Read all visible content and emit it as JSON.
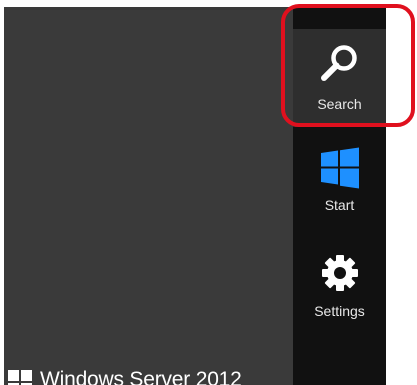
{
  "desktop": {
    "brand_text": "Windows Server 2012"
  },
  "charms": [
    {
      "id": "search",
      "label": "Search",
      "icon": "search-icon"
    },
    {
      "id": "start",
      "label": "Start",
      "icon": "windows-logo-icon"
    },
    {
      "id": "settings",
      "label": "Settings",
      "icon": "gear-icon"
    }
  ],
  "colors": {
    "charms_bar": "#111111",
    "selected_charm": "#2e2e2e",
    "desktop": "#3a3a3a",
    "start_logo": "#1e90ff",
    "highlight": "#e0101e"
  }
}
